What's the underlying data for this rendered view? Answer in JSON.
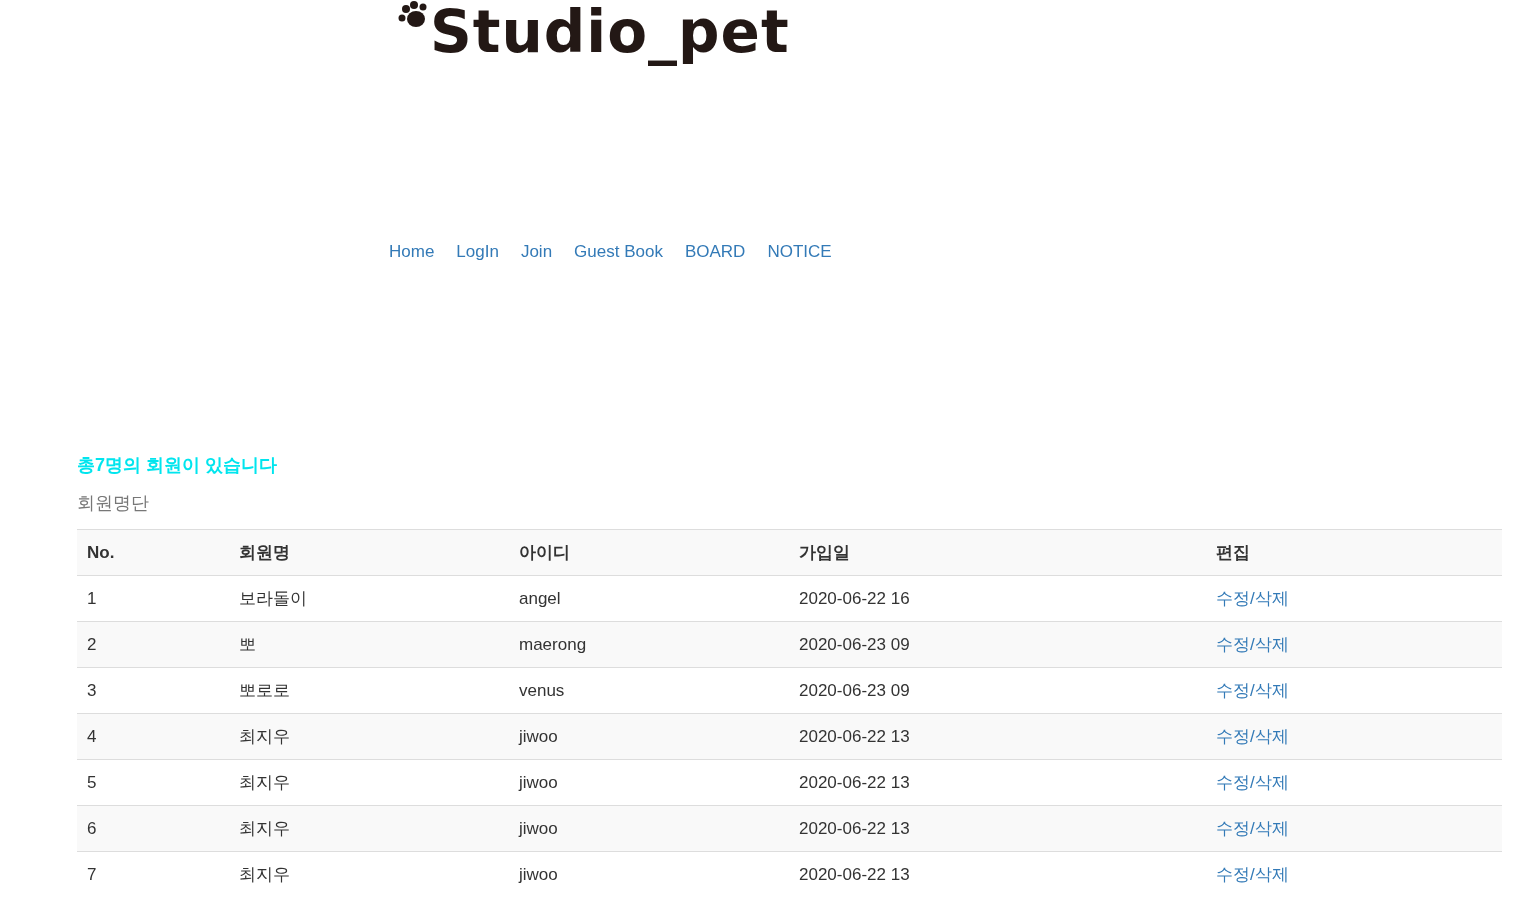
{
  "logo": {
    "text": "Studio_pet"
  },
  "nav": [
    "Home",
    "LogIn",
    "Join",
    "Guest Book",
    "BOARD",
    "NOTICE"
  ],
  "summary": "총7명의 회원이 있습니다",
  "caption": "회원명단",
  "table": {
    "columns": [
      "No.",
      "회원명",
      "아이디",
      "가입일",
      "편집"
    ],
    "rows": [
      {
        "no": "1",
        "name": "보라돌이",
        "id": "angel",
        "joined": "2020-06-22 16",
        "edit": "수정/삭제"
      },
      {
        "no": "2",
        "name": "뽀",
        "id": "maerong",
        "joined": "2020-06-23 09",
        "edit": "수정/삭제"
      },
      {
        "no": "3",
        "name": "뽀로로",
        "id": "venus",
        "joined": "2020-06-23 09",
        "edit": "수정/삭제"
      },
      {
        "no": "4",
        "name": "최지우",
        "id": "jiwoo",
        "joined": "2020-06-22 13",
        "edit": "수정/삭제"
      },
      {
        "no": "5",
        "name": "최지우",
        "id": "jiwoo",
        "joined": "2020-06-22 13",
        "edit": "수정/삭제"
      },
      {
        "no": "6",
        "name": "최지우",
        "id": "jiwoo",
        "joined": "2020-06-22 13",
        "edit": "수정/삭제"
      },
      {
        "no": "7",
        "name": "최지우",
        "id": "jiwoo",
        "joined": "2020-06-22 13",
        "edit": "수정/삭제"
      }
    ]
  }
}
